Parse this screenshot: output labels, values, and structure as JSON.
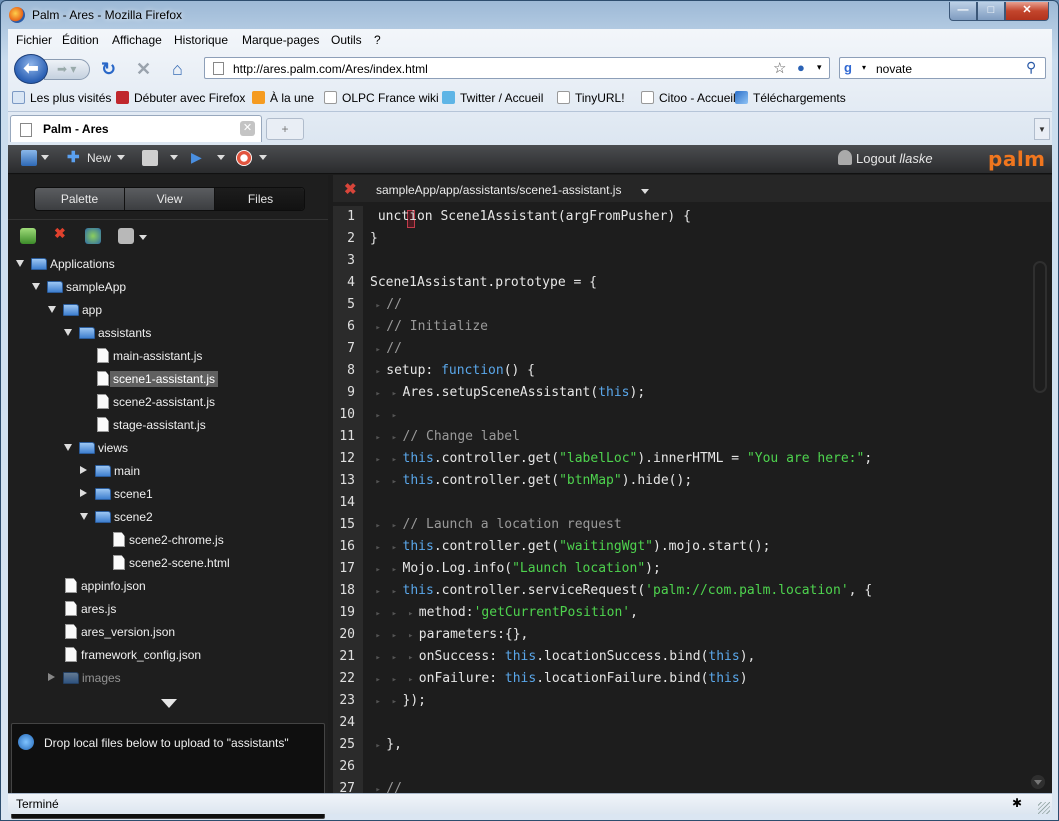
{
  "window": {
    "title": "Palm - Ares - Mozilla Firefox"
  },
  "menubar": {
    "items": [
      "Fichier",
      "Édition",
      "Affichage",
      "Historique",
      "Marque-pages",
      "Outils",
      "?"
    ]
  },
  "nav": {
    "url": "http://ares.palm.com/Ares/index.html",
    "search_value": "novate"
  },
  "bookmarks": [
    "Les plus visités",
    "Débuter avec Firefox",
    "À la une",
    "OLPC France wiki",
    "Twitter / Accueil",
    "TinyURL!",
    "Citoo - Accueil",
    "Téléchargements"
  ],
  "tab": {
    "label": "Palm - Ares"
  },
  "app_toolbar": {
    "new_label": "New",
    "logout_label": "Logout",
    "username": "llaske",
    "brand": "palm"
  },
  "left": {
    "segments": [
      "Palette",
      "View",
      "Files"
    ],
    "selected_segment": "Files",
    "tree": [
      {
        "label": "Applications",
        "depth": 0,
        "type": "folder",
        "state": "open"
      },
      {
        "label": "sampleApp",
        "depth": 1,
        "type": "folder",
        "state": "open"
      },
      {
        "label": "app",
        "depth": 2,
        "type": "folder",
        "state": "open"
      },
      {
        "label": "assistants",
        "depth": 3,
        "type": "folder",
        "state": "open"
      },
      {
        "label": "main-assistant.js",
        "depth": 4,
        "type": "file"
      },
      {
        "label": "scene1-assistant.js",
        "depth": 4,
        "type": "file",
        "selected": true
      },
      {
        "label": "scene2-assistant.js",
        "depth": 4,
        "type": "file"
      },
      {
        "label": "stage-assistant.js",
        "depth": 4,
        "type": "file"
      },
      {
        "label": "views",
        "depth": 3,
        "type": "folder",
        "state": "open"
      },
      {
        "label": "main",
        "depth": 4,
        "type": "folder",
        "state": "closed"
      },
      {
        "label": "scene1",
        "depth": 4,
        "type": "folder",
        "state": "closed"
      },
      {
        "label": "scene2",
        "depth": 4,
        "type": "folder",
        "state": "open"
      },
      {
        "label": "scene2-chrome.js",
        "depth": 5,
        "type": "file"
      },
      {
        "label": "scene2-scene.html",
        "depth": 5,
        "type": "file"
      },
      {
        "label": "appinfo.json",
        "depth": 2,
        "type": "file"
      },
      {
        "label": "ares.js",
        "depth": 2,
        "type": "file"
      },
      {
        "label": "ares_version.json",
        "depth": 2,
        "type": "file"
      },
      {
        "label": "framework_config.json",
        "depth": 2,
        "type": "file"
      },
      {
        "label": "images",
        "depth": 2,
        "type": "folder",
        "state": "closed"
      }
    ],
    "drop_text": "Drop local files below to upload to \"assistants\""
  },
  "editor": {
    "path": "sampleApp/app/assistants/scene1-assistant.js",
    "lines": [
      {
        "n": "1",
        "indent": 0,
        "segs": [
          [
            "",
            "unction "
          ],
          [
            "",
            "Scene1Assistant(argFromPusher) {"
          ]
        ]
      },
      {
        "n": "2",
        "indent": 0,
        "segs": [
          [
            "",
            "}"
          ]
        ]
      },
      {
        "n": "3",
        "indent": 0,
        "segs": []
      },
      {
        "n": "4",
        "indent": 0,
        "segs": [
          [
            "",
            "Scene1Assistant.prototype = {"
          ]
        ]
      },
      {
        "n": "5",
        "indent": 1,
        "segs": [
          [
            "cm",
            "//"
          ]
        ]
      },
      {
        "n": "6",
        "indent": 1,
        "segs": [
          [
            "cm",
            "// Initialize"
          ]
        ]
      },
      {
        "n": "7",
        "indent": 1,
        "segs": [
          [
            "cm",
            "//"
          ]
        ]
      },
      {
        "n": "8",
        "indent": 1,
        "segs": [
          [
            "",
            "setup: "
          ],
          [
            "kw",
            "function"
          ],
          [
            "",
            "() {"
          ]
        ]
      },
      {
        "n": "9",
        "indent": 2,
        "segs": [
          [
            "",
            "Ares.setupSceneAssistant("
          ],
          [
            "kw",
            "this"
          ],
          [
            "",
            ");"
          ]
        ]
      },
      {
        "n": "10",
        "indent": 2,
        "segs": []
      },
      {
        "n": "11",
        "indent": 2,
        "segs": [
          [
            "cm",
            "// Change label"
          ]
        ]
      },
      {
        "n": "12",
        "indent": 2,
        "segs": [
          [
            "kw",
            "this"
          ],
          [
            "",
            ".controller.get("
          ],
          [
            "st",
            "\"labelLoc\""
          ],
          [
            "",
            ").innerHTML = "
          ],
          [
            "st",
            "\"You are here:\""
          ],
          [
            "",
            ";"
          ]
        ]
      },
      {
        "n": "13",
        "indent": 2,
        "segs": [
          [
            "kw",
            "this"
          ],
          [
            "",
            ".controller.get("
          ],
          [
            "st",
            "\"btnMap\""
          ],
          [
            "",
            ").hide();"
          ]
        ]
      },
      {
        "n": "14",
        "indent": 0,
        "segs": []
      },
      {
        "n": "15",
        "indent": 2,
        "segs": [
          [
            "cm",
            "// Launch a location request"
          ]
        ]
      },
      {
        "n": "16",
        "indent": 2,
        "segs": [
          [
            "kw",
            "this"
          ],
          [
            "",
            ".controller.get("
          ],
          [
            "st",
            "\"waitingWgt\""
          ],
          [
            "",
            ").mojo.start();"
          ]
        ]
      },
      {
        "n": "17",
        "indent": 2,
        "segs": [
          [
            "",
            "Mojo.Log.info("
          ],
          [
            "st",
            "\"Launch location\""
          ],
          [
            "",
            ");"
          ]
        ]
      },
      {
        "n": "18",
        "indent": 2,
        "segs": [
          [
            "kw",
            "this"
          ],
          [
            "",
            ".controller.serviceRequest("
          ],
          [
            "st",
            "'palm://com.palm.location'"
          ],
          [
            "",
            ", {"
          ]
        ]
      },
      {
        "n": "19",
        "indent": 3,
        "segs": [
          [
            "",
            "method:"
          ],
          [
            "st",
            "'getCurrentPosition'"
          ],
          [
            "",
            ","
          ]
        ]
      },
      {
        "n": "20",
        "indent": 3,
        "segs": [
          [
            "",
            "parameters:{},"
          ]
        ]
      },
      {
        "n": "21",
        "indent": 3,
        "segs": [
          [
            "",
            "onSuccess: "
          ],
          [
            "kw",
            "this"
          ],
          [
            "",
            ".locationSuccess.bind("
          ],
          [
            "kw",
            "this"
          ],
          [
            "",
            "),"
          ]
        ]
      },
      {
        "n": "22",
        "indent": 3,
        "segs": [
          [
            "",
            "onFailure: "
          ],
          [
            "kw",
            "this"
          ],
          [
            "",
            ".locationFailure.bind("
          ],
          [
            "kw",
            "this"
          ],
          [
            "",
            ")"
          ]
        ]
      },
      {
        "n": "23",
        "indent": 2,
        "segs": [
          [
            "",
            "});"
          ]
        ]
      },
      {
        "n": "24",
        "indent": 0,
        "segs": []
      },
      {
        "n": "25",
        "indent": 1,
        "segs": [
          [
            "",
            "},"
          ]
        ]
      },
      {
        "n": "26",
        "indent": 0,
        "segs": []
      },
      {
        "n": "27",
        "indent": 1,
        "segs": [
          [
            "cm",
            "//"
          ]
        ]
      }
    ]
  },
  "status": {
    "text": "Terminé"
  },
  "colors": {
    "brand": "#f0761e",
    "keyword": "#5aa7ea",
    "string": "#4ed34e",
    "comment": "#9a9a9a"
  }
}
